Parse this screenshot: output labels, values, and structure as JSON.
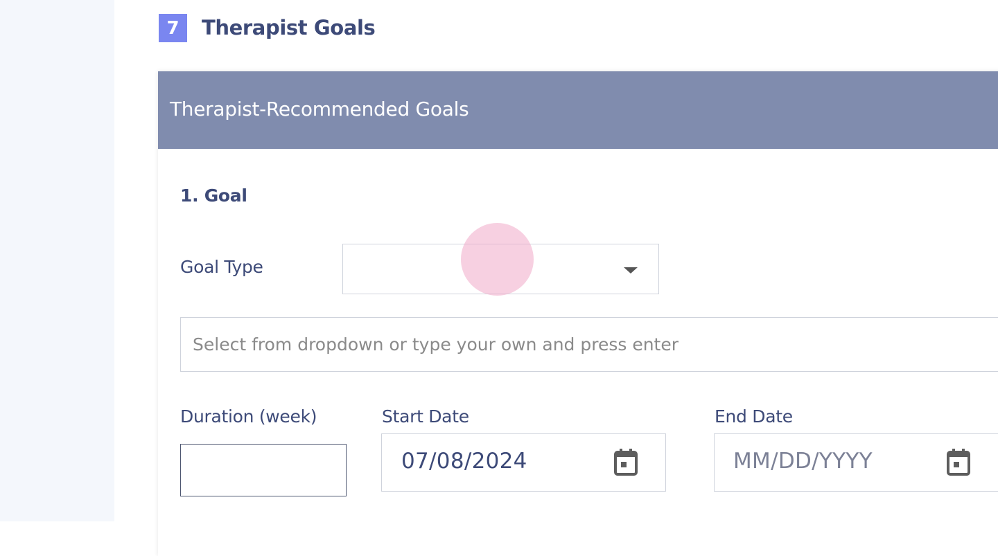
{
  "section": {
    "number": "7",
    "title": "Therapist Goals"
  },
  "card": {
    "header_title": "Therapist-Recommended Goals"
  },
  "goal": {
    "heading": "1. Goal",
    "goal_type_label": "Goal Type",
    "goal_type_value": "",
    "goal_text_placeholder": "Select from dropdown or type your own and press enter",
    "duration_label": "Duration (week)",
    "duration_value": "",
    "start_date_label": "Start Date",
    "start_date_value": "07/08/2024",
    "end_date_label": "End Date",
    "end_date_placeholder": "MM/DD/YYYY"
  },
  "icons": {
    "dropdown": "caret-down-icon",
    "calendar": "calendar-icon"
  },
  "colors": {
    "section_badge": "#7a86f0",
    "card_header": "#808cae",
    "text_primary": "#3d4a78",
    "left_rail": "#f4f7fc",
    "click_marker": "#f5cde0"
  }
}
